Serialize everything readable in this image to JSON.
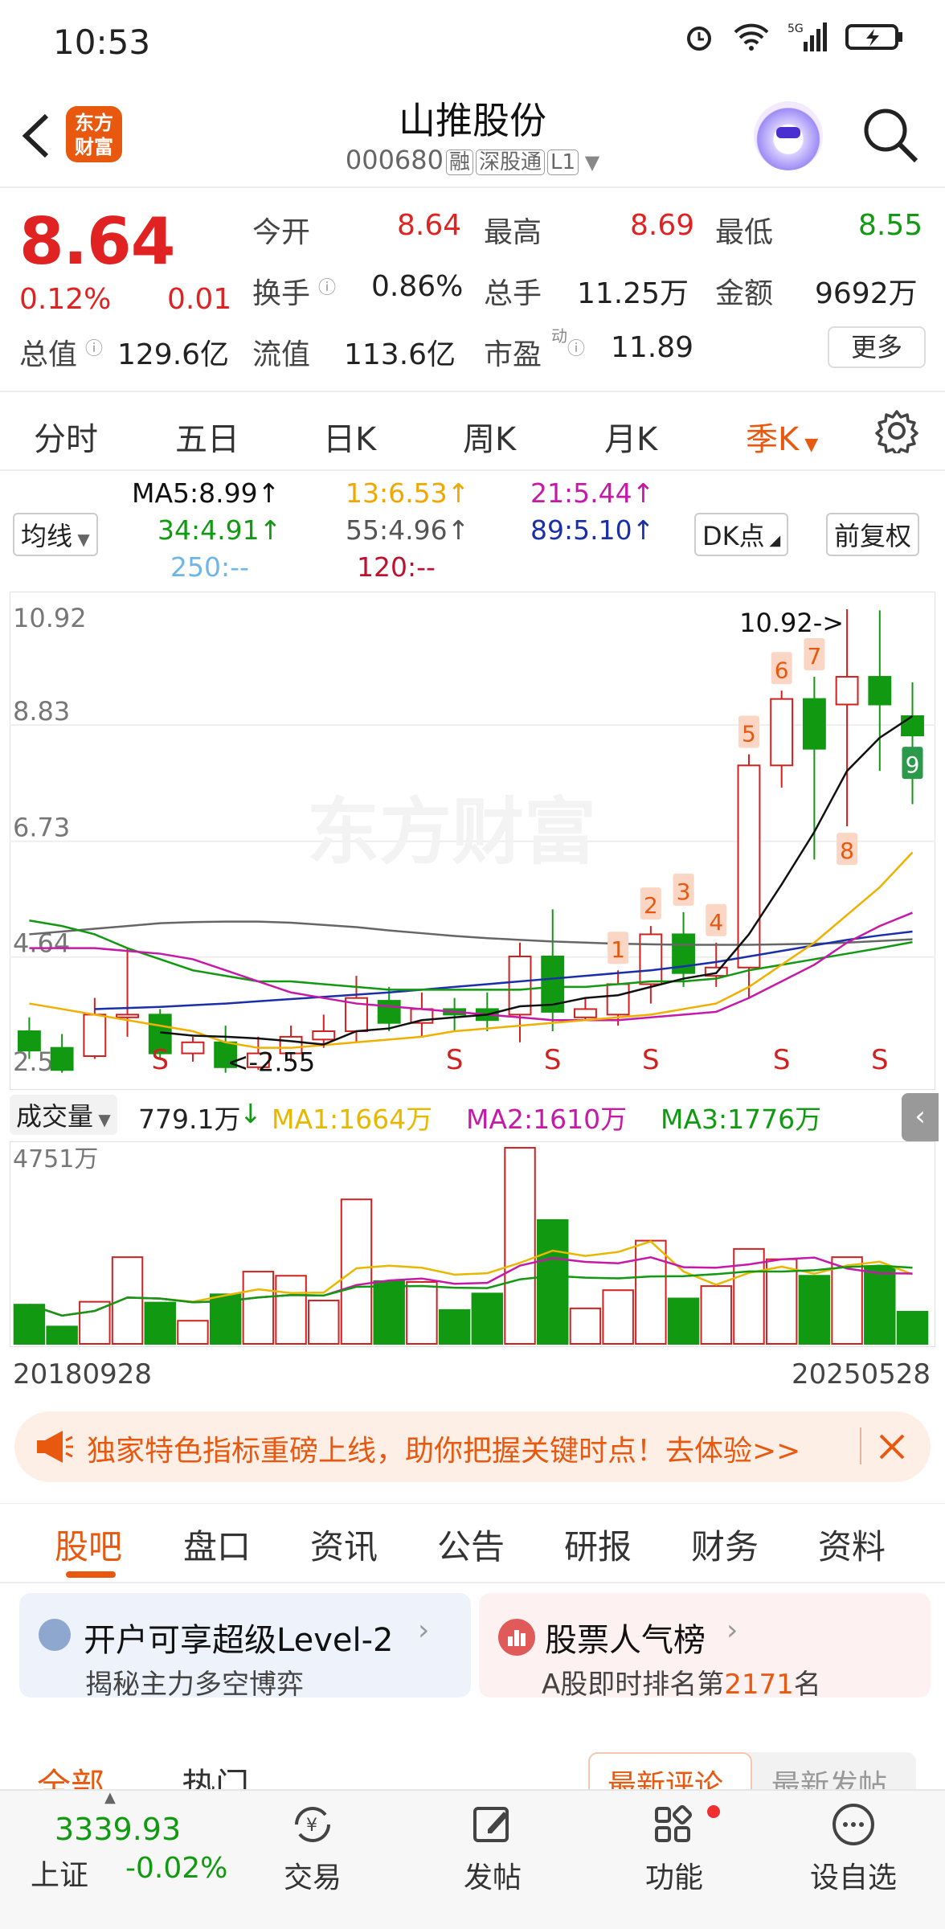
{
  "status": {
    "time": "10:53",
    "network": "5G"
  },
  "header": {
    "back_icon": "chevron-left",
    "logo": "东方\n财富",
    "title": "山推股份",
    "code": "000680",
    "tags": [
      "融",
      "深股通",
      "L1"
    ]
  },
  "quote": {
    "price": "8.64",
    "change_pct": "0.12%",
    "change": "0.01",
    "open_label": "今开",
    "open": "8.64",
    "high_label": "最高",
    "high": "8.69",
    "low_label": "最低",
    "low": "8.55",
    "turnover_label": "换手",
    "turnover": "0.86%",
    "volume_label": "总手",
    "volume": "11.25万",
    "amount_label": "金额",
    "amount": "9692万",
    "mktcap_label": "总值",
    "mktcap": "129.6亿",
    "float_label": "流值",
    "float": "113.6亿",
    "pe_label": "市盈",
    "pe_sup": "动",
    "pe": "11.89",
    "more": "更多"
  },
  "kline_tabs": [
    "分时",
    "五日",
    "日K",
    "周K",
    "月K",
    "季K"
  ],
  "active_tab": "季K",
  "ma": {
    "selector": "均线",
    "ma5": "MA5:8.99↑",
    "ma13": "13:6.53↑",
    "ma21": "21:5.44↑",
    "ma34": "34:4.91↑",
    "ma55": "55:4.96↑",
    "ma89": "89:5.10↑",
    "ma250": "250:--",
    "ma120": "120:--",
    "dk": "DK点",
    "adjust": "前复权"
  },
  "chart_data": {
    "type": "candlestick",
    "y_ticks": [
      "10.92",
      "8.83",
      "6.73",
      "4.64",
      "2.56"
    ],
    "ylim": [
      2.56,
      10.92
    ],
    "high_label": "10.92->",
    "low_label": "<-2.55",
    "candles": [
      {
        "o": 3.3,
        "c": 2.95,
        "h": 3.55,
        "l": 2.8
      },
      {
        "o": 3.0,
        "c": 2.6,
        "h": 3.25,
        "l": 2.55
      },
      {
        "o": 2.85,
        "c": 3.6,
        "h": 3.9,
        "l": 2.8
      },
      {
        "o": 3.55,
        "c": 3.6,
        "h": 4.8,
        "l": 3.2
      },
      {
        "o": 3.6,
        "c": 2.9,
        "h": 3.7,
        "l": 2.8
      },
      {
        "o": 2.9,
        "c": 3.1,
        "h": 3.2,
        "l": 2.75
      },
      {
        "o": 3.1,
        "c": 2.65,
        "h": 3.4,
        "l": 2.55
      },
      {
        "o": 2.65,
        "c": 2.9,
        "h": 3.2,
        "l": 2.6
      },
      {
        "o": 2.9,
        "c": 3.2,
        "h": 3.4,
        "l": 2.75
      },
      {
        "o": 3.15,
        "c": 3.3,
        "h": 3.6,
        "l": 3.0
      },
      {
        "o": 3.3,
        "c": 3.9,
        "h": 4.3,
        "l": 3.1
      },
      {
        "o": 3.85,
        "c": 3.45,
        "h": 4.1,
        "l": 3.3
      },
      {
        "o": 3.45,
        "c": 3.7,
        "h": 4.0,
        "l": 3.2
      },
      {
        "o": 3.7,
        "c": 3.6,
        "h": 3.9,
        "l": 3.3
      },
      {
        "o": 3.7,
        "c": 3.5,
        "h": 4.0,
        "l": 3.3
      },
      {
        "o": 3.6,
        "c": 4.65,
        "h": 4.9,
        "l": 3.1
      },
      {
        "o": 4.65,
        "c": 3.65,
        "h": 5.5,
        "l": 3.3
      },
      {
        "o": 3.55,
        "c": 3.7,
        "h": 3.9,
        "l": 3.5
      },
      {
        "o": 3.6,
        "c": 4.15,
        "h": 4.4,
        "l": 3.4
      },
      {
        "o": 4.15,
        "c": 5.05,
        "h": 5.2,
        "l": 3.8
      },
      {
        "o": 5.05,
        "c": 4.35,
        "h": 5.45,
        "l": 4.1
      },
      {
        "o": 4.3,
        "c": 4.45,
        "h": 4.9,
        "l": 4.1
      },
      {
        "o": 4.45,
        "c": 8.1,
        "h": 8.3,
        "l": 3.9
      },
      {
        "o": 8.1,
        "c": 9.3,
        "h": 9.45,
        "l": 7.7
      },
      {
        "o": 9.3,
        "c": 8.4,
        "h": 9.7,
        "l": 6.4
      },
      {
        "o": 9.2,
        "c": 9.7,
        "h": 10.92,
        "l": 7.0
      },
      {
        "o": 9.7,
        "c": 9.2,
        "h": 10.9,
        "l": 8.0
      },
      {
        "o": 8.99,
        "c": 8.64,
        "h": 9.6,
        "l": 7.4
      }
    ],
    "labels": [
      {
        "text": "1",
        "i": 18
      },
      {
        "text": "2",
        "i": 19
      },
      {
        "text": "3",
        "i": 20
      },
      {
        "text": "4",
        "i": 21
      },
      {
        "text": "5",
        "i": 22
      },
      {
        "text": "6",
        "i": 23
      },
      {
        "text": "7",
        "i": 24
      },
      {
        "text": "8",
        "i": 25
      },
      {
        "text": "9",
        "i": 27
      }
    ],
    "s_marks": [
      4,
      13,
      16,
      19,
      23,
      26
    ],
    "ma5": [
      null,
      null,
      null,
      null,
      3.28,
      3.22,
      3.2,
      3.17,
      3.12,
      3.06,
      3.3,
      3.35,
      3.5,
      3.55,
      3.6,
      3.75,
      3.78,
      3.9,
      3.95,
      4.1,
      4.25,
      4.35,
      5.05,
      5.95,
      6.9,
      8.0,
      8.6,
      8.99
    ],
    "ma13": [
      3.8,
      3.7,
      3.6,
      3.5,
      3.4,
      3.3,
      3.1,
      3.0,
      3.0,
      3.05,
      3.1,
      3.15,
      3.2,
      3.3,
      3.35,
      3.4,
      3.45,
      3.5,
      3.55,
      3.6,
      3.7,
      3.8,
      4.1,
      4.5,
      4.9,
      5.4,
      5.9,
      6.53
    ],
    "ma21": [
      4.8,
      4.8,
      4.8,
      4.75,
      4.7,
      4.6,
      4.4,
      4.2,
      4.0,
      3.9,
      3.8,
      3.75,
      3.7,
      3.65,
      3.6,
      3.55,
      3.5,
      3.5,
      3.5,
      3.55,
      3.6,
      3.65,
      3.9,
      4.2,
      4.5,
      4.9,
      5.2,
      5.44
    ],
    "ma34": [
      5.3,
      5.2,
      5.05,
      4.8,
      4.6,
      4.4,
      4.3,
      4.2,
      4.2,
      4.15,
      4.1,
      4.05,
      4.05,
      4.05,
      4.05,
      4.05,
      4.1,
      4.1,
      4.15,
      4.2,
      4.2,
      4.25,
      4.4,
      4.5,
      4.6,
      4.7,
      4.8,
      4.91
    ],
    "ma55": [
      5.05,
      5.1,
      5.15,
      5.2,
      5.25,
      5.27,
      5.28,
      5.28,
      5.26,
      5.22,
      5.18,
      5.12,
      5.07,
      5.02,
      4.98,
      4.95,
      4.92,
      4.9,
      4.88,
      4.87,
      4.86,
      4.86,
      4.86,
      4.87,
      4.88,
      4.9,
      4.93,
      4.96
    ],
    "ma89": [
      null,
      null,
      3.7,
      3.72,
      3.74,
      3.77,
      3.8,
      3.84,
      3.88,
      3.92,
      3.96,
      4.0,
      4.05,
      4.1,
      4.15,
      4.2,
      4.25,
      4.3,
      4.35,
      4.4,
      4.47,
      4.55,
      4.65,
      4.75,
      4.85,
      4.95,
      5.03,
      5.1
    ],
    "volume": {
      "label": "成交量",
      "value": "779.1万",
      "ma1": "MA1:1664万",
      "ma2": "MA2:1610万",
      "ma3": "MA3:1776万",
      "ymax_label": "4751万",
      "values": [
        950,
        420,
        1020,
        2100,
        1000,
        560,
        1200,
        1750,
        1650,
        1050,
        3500,
        1520,
        1500,
        820,
        1220,
        4750,
        3000,
        860,
        1300,
        2500,
        1100,
        1400,
        2300,
        2050,
        1650,
        2100,
        1850,
        779
      ]
    }
  },
  "dates": {
    "start": "20180928",
    "end": "20250528"
  },
  "banner": {
    "text": "独家特色指标重磅上线，助你把握关键时点！去体验>>"
  },
  "bottom_tabs": [
    "股吧",
    "盘口",
    "资讯",
    "公告",
    "研报",
    "财务",
    "资料"
  ],
  "cards": [
    {
      "title": "开户可享超级Level-2",
      "sub": "揭秘主力多空博弈"
    },
    {
      "title": "股票人气榜",
      "sub_prefix": "A股即时排名第",
      "sub_rank": "2171",
      "sub_suffix": "名"
    }
  ],
  "filters": {
    "all": "全部",
    "hot": "热门",
    "latest_comment": "最新评论",
    "latest_post": "最新发帖"
  },
  "nav": {
    "index_value": "3339.93",
    "index_name": "上证",
    "index_change": "-0.02%",
    "trade": "交易",
    "post": "发帖",
    "function": "功能",
    "watch": "设自选"
  }
}
